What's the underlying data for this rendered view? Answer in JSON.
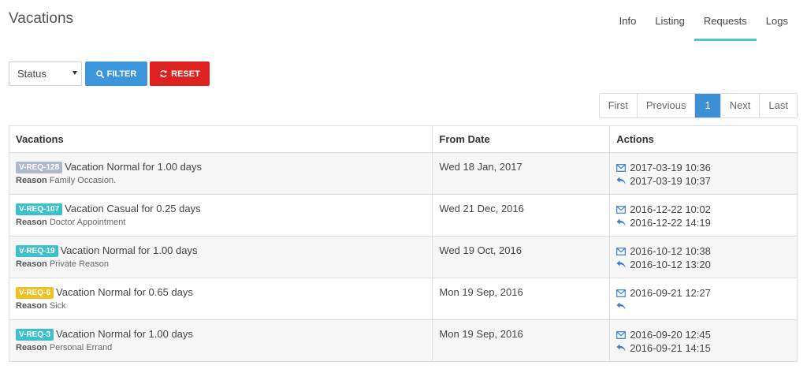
{
  "header": {
    "title": "Vacations"
  },
  "tabs": [
    {
      "label": "Info",
      "active": false
    },
    {
      "label": "Listing",
      "active": false
    },
    {
      "label": "Requests",
      "active": true
    },
    {
      "label": "Logs",
      "active": false
    }
  ],
  "filter": {
    "status_value": "Status",
    "filter_label": "FILTER",
    "reset_label": "RESET"
  },
  "pager": {
    "first": "First",
    "previous": "Previous",
    "current": "1",
    "next": "Next",
    "last": "Last"
  },
  "table": {
    "columns": [
      "Vacations",
      "From Date",
      "Actions"
    ],
    "reason_label": "Reason",
    "rows": [
      {
        "badge": "V-REQ-128",
        "badge_color": "#aeb8c8",
        "title": "Vacation Normal for 1.00 days",
        "reason": "Family Occasion.",
        "from_date": "Wed 18 Jan, 2017",
        "sent": "2017-03-19 10:36",
        "replied": "2017-03-19 10:37"
      },
      {
        "badge": "V-REQ-107",
        "badge_color": "#3cc0cc",
        "title": "Vacation Casual for 0.25 days",
        "reason": "Doctor Appointment",
        "from_date": "Wed 21 Dec, 2016",
        "sent": "2016-12-22 10:02",
        "replied": "2016-12-22 14:19"
      },
      {
        "badge": "V-REQ-19",
        "badge_color": "#3cc0cc",
        "title": "Vacation Normal for 1.00 days",
        "reason": "Private Reason",
        "from_date": "Wed 19 Oct, 2016",
        "sent": "2016-10-12 10:38",
        "replied": "2016-10-12 13:20"
      },
      {
        "badge": "V-REQ-6",
        "badge_color": "#f0c020",
        "title": "Vacation Normal for 0.65 days",
        "reason": "Sick",
        "from_date": "Mon 19 Sep, 2016",
        "sent": "2016-09-21 12:27",
        "replied": ""
      },
      {
        "badge": "V-REQ-3",
        "badge_color": "#3cc0cc",
        "title": "Vacation Normal for 1.00 days",
        "reason": "Personal Errand",
        "from_date": "Mon 19 Sep, 2016",
        "sent": "2016-09-20 12:45",
        "replied": "2016-09-21 14:15"
      }
    ]
  },
  "icons": {
    "filter": "search-icon",
    "reset": "refresh-icon",
    "sent": "envelope-icon",
    "reply": "reply-icon"
  },
  "colors": {
    "accent": "#3d96db",
    "danger": "#dd2222",
    "tab_underline": "#4ec3d2",
    "icon": "#3d7fc4"
  }
}
